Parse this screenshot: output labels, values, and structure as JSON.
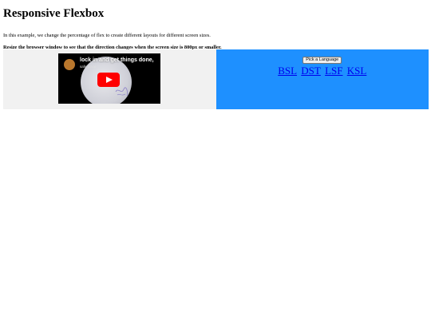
{
  "page": {
    "title": "Responsive Flexbox",
    "intro": "In this example, we change the percentage of flex to create different layouts for different screen sizes.",
    "note": "Resize the browser window to see that the direction changes when the screen size is 800px or smaller."
  },
  "video": {
    "title": "lock in and get things done,",
    "subtitle": "safe place",
    "icons": [
      "channel-avatar",
      "youtube-play-icon"
    ]
  },
  "language_picker": {
    "button_label": "Pick a Language",
    "links": [
      "BSL",
      "DST",
      "LSF",
      "KSL"
    ]
  },
  "colors": {
    "left_panel": "#f1f1f1",
    "right_panel": "#1e90ff",
    "play_button": "#ff0000",
    "link": "#0000ee"
  }
}
